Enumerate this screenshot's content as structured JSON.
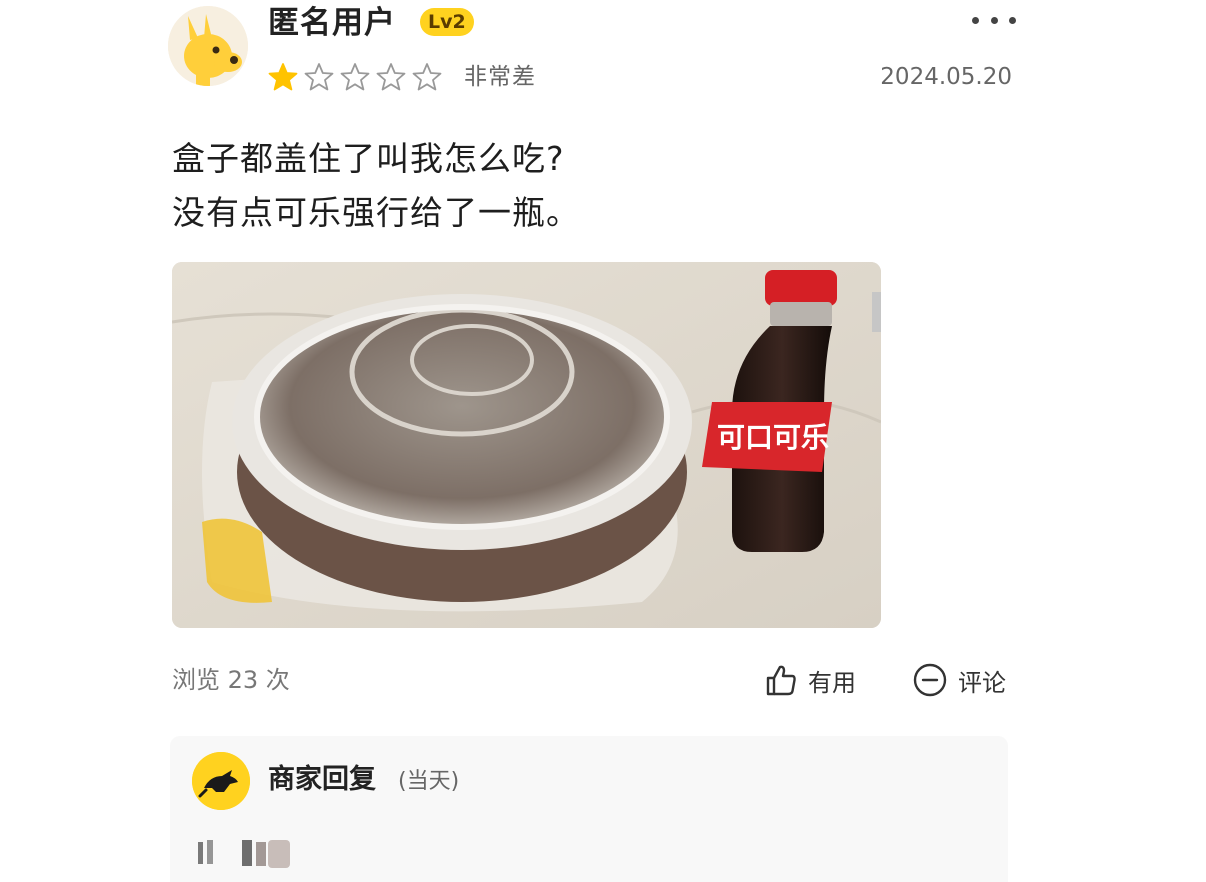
{
  "review": {
    "user": {
      "name": "匿名用户",
      "level": "Lv2"
    },
    "rating": {
      "stars": 1,
      "max": 5,
      "label": "非常差"
    },
    "date": "2024.05.20",
    "text_lines": [
      "盒子都盖住了叫我怎么吃?",
      "没有点可乐强行给了一瓶。"
    ],
    "photo": {
      "bottle_label": "可口可乐"
    },
    "views_label": "浏览 23 次",
    "actions": {
      "useful_label": "有用",
      "comment_label": "评论"
    }
  },
  "merchant_reply": {
    "title": "商家回复",
    "when": "(当天)"
  },
  "colors": {
    "star_active": "#ffc300",
    "badge": "#ffd21f",
    "text_primary": "#222222",
    "text_secondary": "#666666"
  }
}
